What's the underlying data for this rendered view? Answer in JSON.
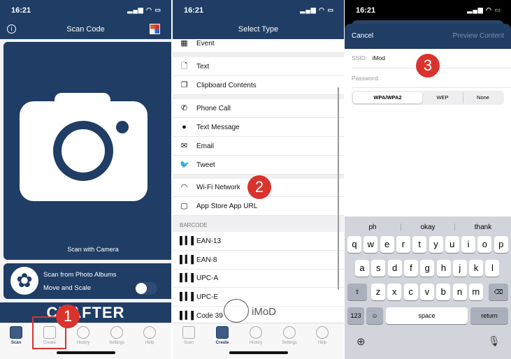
{
  "colors": {
    "navy": "#1f3d65",
    "badge": "#d8342d"
  },
  "status": {
    "time": "16:21"
  },
  "screen1": {
    "title": "Scan Code",
    "info_icon": "info-icon",
    "camera_label": "Scan with Camera",
    "albums_label": "Scan from Photo Albums",
    "move_scale_label": "Move and Scale",
    "move_scale_on": false,
    "banner": "CRAFTER",
    "badge": "1"
  },
  "tabs": [
    {
      "label": "Scan",
      "icon": "qr-scan-icon"
    },
    {
      "label": "Create",
      "icon": "edit-icon"
    },
    {
      "label": "History",
      "icon": "clock-icon"
    },
    {
      "label": "Settings",
      "icon": "gear-icon"
    },
    {
      "label": "Help",
      "icon": "help-icon"
    }
  ],
  "screen2": {
    "title": "Select Type",
    "badge": "2",
    "items": [
      {
        "label": "Event",
        "icon": "calendar-icon"
      },
      {
        "label": "Text",
        "icon": "document-icon"
      },
      {
        "label": "Clipboard Contents",
        "icon": "clipboard-icon"
      },
      {
        "label": "Phone Call",
        "icon": "phone-icon"
      },
      {
        "label": "Text Message",
        "icon": "message-icon"
      },
      {
        "label": "Email",
        "icon": "mail-icon"
      },
      {
        "label": "Tweet",
        "icon": "twitter-icon"
      },
      {
        "label": "Wi-Fi Network",
        "icon": "wifi-icon"
      },
      {
        "label": "App Store App URL",
        "icon": "app-store-icon"
      }
    ],
    "section": "BARCODE",
    "barcodes": [
      "EAN-13",
      "EAN-8",
      "UPC-A",
      "UPC-E",
      "Code 39"
    ],
    "watermark": "iMoD"
  },
  "screen3": {
    "cancel": "Cancel",
    "preview": "Preview Content",
    "ssid_label": "SSID:",
    "ssid_value": "iMod",
    "password_label": "Password:",
    "password_value": "",
    "segments": [
      "WPA/WPA2",
      "WEP",
      "None"
    ],
    "selected_segment": "WPA/WPA2",
    "badge": "3",
    "suggestions": [
      "ph",
      "okay",
      "thank"
    ],
    "rows": [
      [
        "q",
        "w",
        "e",
        "r",
        "t",
        "y",
        "u",
        "i",
        "o",
        "p"
      ],
      [
        "a",
        "s",
        "d",
        "f",
        "g",
        "h",
        "j",
        "k",
        "l"
      ],
      [
        "z",
        "x",
        "c",
        "v",
        "b",
        "n",
        "m"
      ]
    ],
    "num_key": "123",
    "space_key": "space",
    "return_key": "return"
  }
}
